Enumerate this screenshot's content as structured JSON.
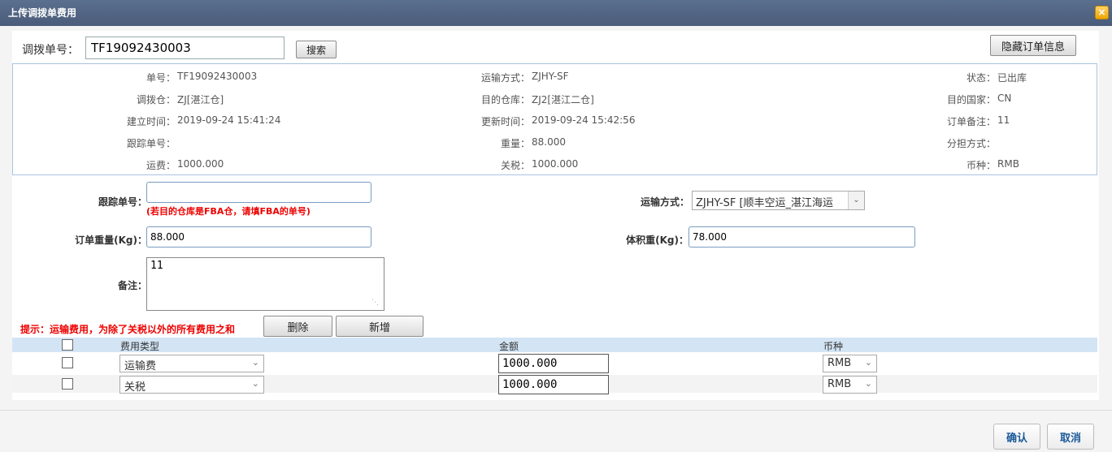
{
  "window": {
    "title": "上传调拨单费用",
    "close_icon": "×"
  },
  "search": {
    "label": "调拨单号：",
    "value": "TF19092430003",
    "button": "搜索"
  },
  "hide_order_button": "隐藏订单信息",
  "info": {
    "order_no": {
      "label": "单号：",
      "value": "TF19092430003"
    },
    "transport": {
      "label": "运输方式：",
      "value": "ZJHY-SF"
    },
    "status": {
      "label": "状态：",
      "value": "已出库"
    },
    "from_wh": {
      "label": "调拨仓：",
      "value": "ZJ[湛江仓]"
    },
    "to_wh": {
      "label": "目的仓库：",
      "value": "ZJ2[湛江二仓]"
    },
    "country": {
      "label": "目的国家：",
      "value": "CN"
    },
    "created": {
      "label": "建立时间：",
      "value": "2019-09-24 15:41:24"
    },
    "updated": {
      "label": "更新时间：",
      "value": "2019-09-24 15:42:56"
    },
    "remark": {
      "label": "订单备注：",
      "value": "11"
    },
    "tracking": {
      "label": "跟踪单号：",
      "value": ""
    },
    "weight": {
      "label": "重量：",
      "value": "88.000"
    },
    "split": {
      "label": "分担方式：",
      "value": ""
    },
    "freight": {
      "label": "运费：",
      "value": "1000.000"
    },
    "tax": {
      "label": "关税：",
      "value": "1000.000"
    },
    "currency": {
      "label": "币种：",
      "value": "RMB"
    }
  },
  "form": {
    "tracking_label": "跟踪单号：",
    "tracking_value": "",
    "tracking_hint": "(若目的仓库是FBA仓，请填FBA的单号)",
    "transport_label": "运输方式：",
    "transport_value": "ZJHY-SF [顺丰空运_湛江海运",
    "weight_label": "订单重量(Kg)：",
    "weight_value": "88.000",
    "volume_label": "体积重(Kg)：",
    "volume_value": "78.000",
    "remark_label": "备注：",
    "remark_value": "11"
  },
  "fee_hint": "提示：运输费用，为除了关税以外的所有费用之和",
  "delete_button": "删除",
  "add_button": "新增",
  "table": {
    "headers": {
      "type": "费用类型",
      "amount": "金额",
      "currency": "币种"
    },
    "rows": [
      {
        "type": "运输费",
        "amount": "1000.000",
        "currency": "RMB"
      },
      {
        "type": "关税",
        "amount": "1000.000",
        "currency": "RMB"
      }
    ]
  },
  "footer": {
    "confirm": "确认",
    "cancel": "取消"
  },
  "colors": {
    "titlebar": "#4f6282",
    "accent_red": "#e00000",
    "header_blue": "#d3e5f5"
  }
}
